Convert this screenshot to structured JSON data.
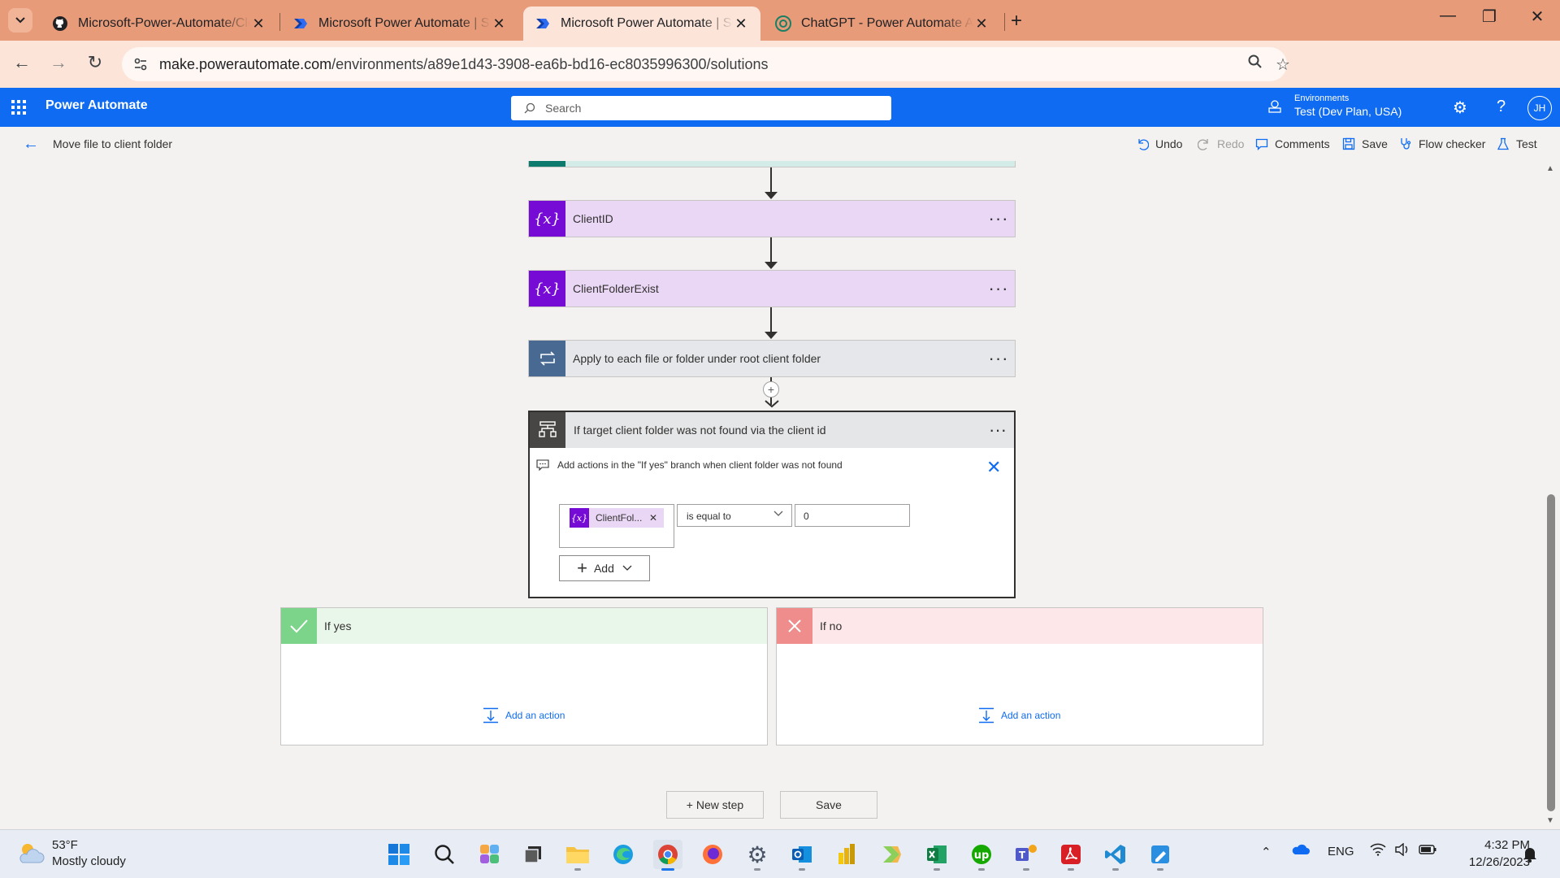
{
  "browser": {
    "tabs": [
      {
        "title": "Microsoft-Power-Automate/Clo",
        "icon": "github-icon",
        "active": false
      },
      {
        "title": "Microsoft Power Automate | So",
        "icon": "power-automate-icon",
        "active": false
      },
      {
        "title": "Microsoft Power Automate | So",
        "icon": "power-automate-icon",
        "active": true
      },
      {
        "title": "ChatGPT - Power Automate Ass",
        "icon": "chatgpt-icon",
        "active": false
      }
    ],
    "url_host": "make.powerautomate.com",
    "url_path": "/environments/a89e1d43-3908-ea6b-bd16-ec8035996300/solutions",
    "accent": "#e89b79"
  },
  "header": {
    "app_name": "Power Automate",
    "search_placeholder": "Search",
    "environments_label": "Environments",
    "environment_name": "Test (Dev Plan, USA)",
    "avatar_initials": "JH",
    "brand_color": "#0f6cf2"
  },
  "commandbar": {
    "flow_name": "Move file to client folder",
    "undo": "Undo",
    "redo": "Redo",
    "comments": "Comments",
    "save": "Save",
    "flow_checker": "Flow checker",
    "test": "Test"
  },
  "canvas": {
    "steps": [
      {
        "label": "ClientID",
        "type": "variable"
      },
      {
        "label": "ClientFolderExist",
        "type": "variable"
      },
      {
        "label": "Apply to each file or folder under root client folder",
        "type": "apply-to-each"
      }
    ],
    "condition": {
      "title": "If target client folder was not found via the client id",
      "comment": "Add actions in the \"If yes\" branch when client folder was not found",
      "token_label": "ClientFol...",
      "operator": "is equal to",
      "value": "0",
      "add_label": "Add"
    },
    "branches": {
      "yes_label": "If yes",
      "no_label": "If no",
      "add_action_label": "Add an action"
    },
    "new_step_label": "+ New step",
    "save_label": "Save"
  },
  "taskbar": {
    "temperature": "53°F",
    "weather": "Mostly cloudy",
    "language": "ENG",
    "time": "4:32 PM",
    "date": "12/26/2023"
  }
}
